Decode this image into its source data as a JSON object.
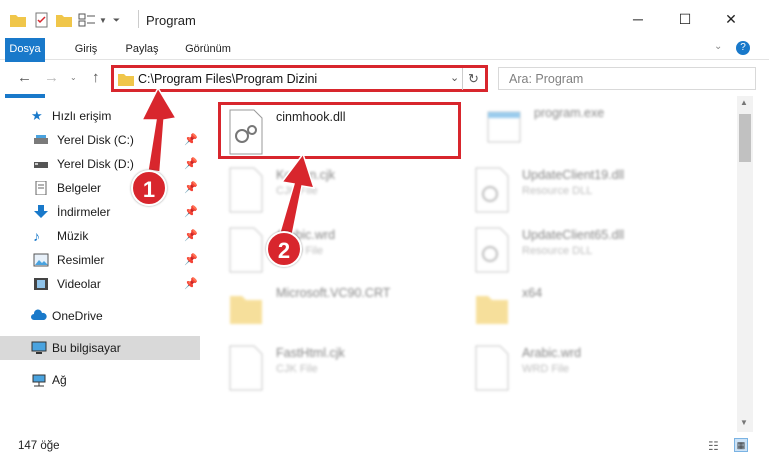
{
  "window": {
    "title": "Program",
    "minimize": "─",
    "maximize": "☐",
    "close": "✕"
  },
  "ribbon": {
    "tabs": [
      "Dosya",
      "Giriş",
      "Paylaş",
      "Görünüm"
    ]
  },
  "navbar": {
    "address": "C:\\Program Files\\Program Dizini",
    "search_placeholder": "Ara: Program"
  },
  "sidebar": {
    "items": [
      {
        "label": "Hızlı erişim",
        "icon": "star-icon"
      },
      {
        "label": "Yerel Disk (C:)",
        "icon": "drive-icon",
        "pinned": true
      },
      {
        "label": "Yerel Disk (D:)",
        "icon": "drive-icon",
        "pinned": true
      },
      {
        "label": "Belgeler",
        "icon": "document-icon",
        "pinned": true
      },
      {
        "label": "İndirmeler",
        "icon": "download-icon",
        "pinned": true
      },
      {
        "label": "Müzik",
        "icon": "music-icon",
        "pinned": true
      },
      {
        "label": "Resimler",
        "icon": "pictures-icon",
        "pinned": true
      },
      {
        "label": "Videolar",
        "icon": "video-icon",
        "pinned": true
      },
      {
        "label": "OneDrive",
        "icon": "cloud-icon"
      },
      {
        "label": "Bu bilgisayar",
        "icon": "computer-icon",
        "selected": true
      },
      {
        "label": "Ağ",
        "icon": "network-icon"
      }
    ]
  },
  "files": [
    {
      "name": "cinmhook.dll",
      "sub": "",
      "icon": "dll-icon",
      "highlighted": true
    },
    {
      "name": "program.exe",
      "sub": "",
      "icon": "exe-icon"
    },
    {
      "name": "Korean.cjk",
      "sub": "CJK File",
      "icon": "file-icon"
    },
    {
      "name": "UpdateClient19.dll",
      "sub": "Resource DLL",
      "icon": "dll-icon"
    },
    {
      "name": "Arabic.wrd",
      "sub": "WRD File",
      "icon": "file-icon"
    },
    {
      "name": "UpdateClient65.dll",
      "sub": "Resource DLL",
      "icon": "dll-icon"
    },
    {
      "name": "Microsoft.VC90.CRT",
      "sub": "",
      "icon": "folder-icon"
    },
    {
      "name": "x64",
      "sub": "",
      "icon": "folder-icon"
    },
    {
      "name": "FastHtml.cjk",
      "sub": "CJK File",
      "icon": "file-icon"
    },
    {
      "name": "Arabic.wrd",
      "sub": "WRD File",
      "icon": "file-icon"
    }
  ],
  "status": {
    "count": "147 öğe"
  },
  "annotations": {
    "step1": "1",
    "step2": "2"
  },
  "colors": {
    "accent": "#1979ca",
    "highlight": "#d8262d"
  }
}
